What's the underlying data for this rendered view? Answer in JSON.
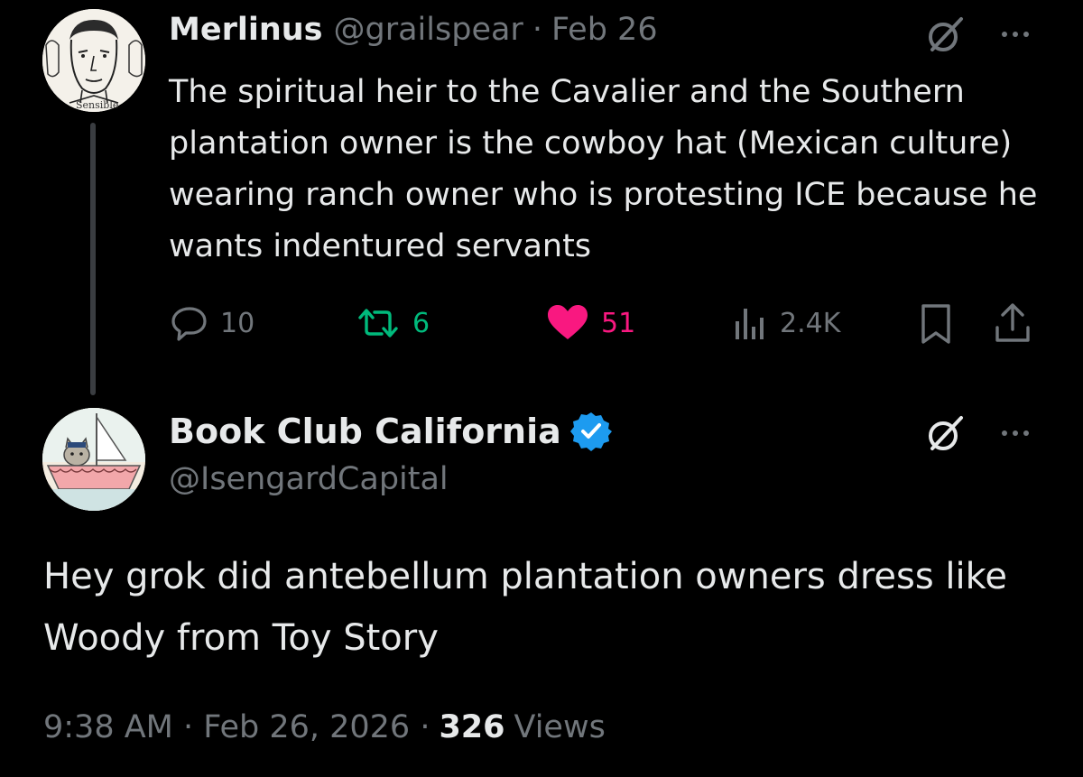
{
  "thread": {
    "parent": {
      "author_name": "Merlinus",
      "author_handle": "@grailspear",
      "separator": "·",
      "date": "Feb 26",
      "avatar_caption": "Sensible",
      "text": "The spiritual heir to the Cavalier and the Southern plantation owner is the cowboy hat (Mexican culture) wearing ranch owner who is protesting ICE because he wants indentured servants",
      "stats": {
        "replies": "10",
        "reposts": "6",
        "likes": "51",
        "views": "2.4K"
      },
      "icons": {
        "grok": "grok-icon",
        "more": "more-icon",
        "reply": "reply-icon",
        "repost": "repost-icon",
        "like": "heart-icon",
        "views": "views-icon",
        "bookmark": "bookmark-icon",
        "share": "share-icon"
      }
    },
    "reply": {
      "author_name": "Book Club California",
      "author_handle": "@IsengardCapital",
      "verified": true,
      "text": "Hey grok did antebellum plantation owners dress like Woody from Toy Story",
      "meta": {
        "time_date": "9:38 AM · Feb 26, 2026 ·",
        "views_count": "326",
        "views_label": "Views"
      }
    }
  },
  "colors": {
    "background": "#000000",
    "text_primary": "#e7e9ea",
    "text_secondary": "#71767b",
    "repost_green": "#00ba7c",
    "like_pink": "#f91880",
    "verified_blue": "#1d9bf0",
    "thread_line": "#3a3d41"
  }
}
